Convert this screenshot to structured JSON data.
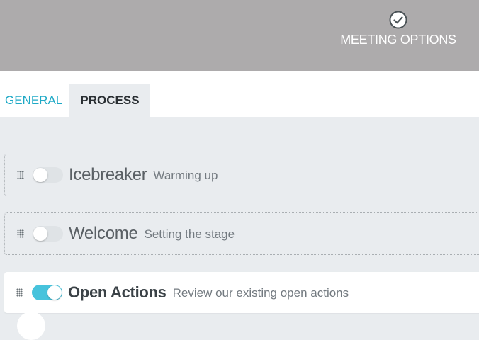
{
  "header": {
    "meeting_options_label": "MEETING OPTIONS",
    "meeting_options_icon": "check-circle-icon",
    "background": "#adabac"
  },
  "tabs": [
    {
      "label": "GENERAL",
      "active": false
    },
    {
      "label": "PROCESS",
      "active": true
    }
  ],
  "stages": [
    {
      "title": "Icebreaker",
      "description": "Warming up",
      "enabled": false
    },
    {
      "title": "Welcome",
      "description": "Setting the stage",
      "enabled": false
    },
    {
      "title": "Open Actions",
      "description": "Review our existing open actions",
      "enabled": true
    }
  ],
  "colors": {
    "accent": "#1fa9c6",
    "toggle_on": "#47c3dc",
    "toggle_off": "#dfe3e6"
  }
}
